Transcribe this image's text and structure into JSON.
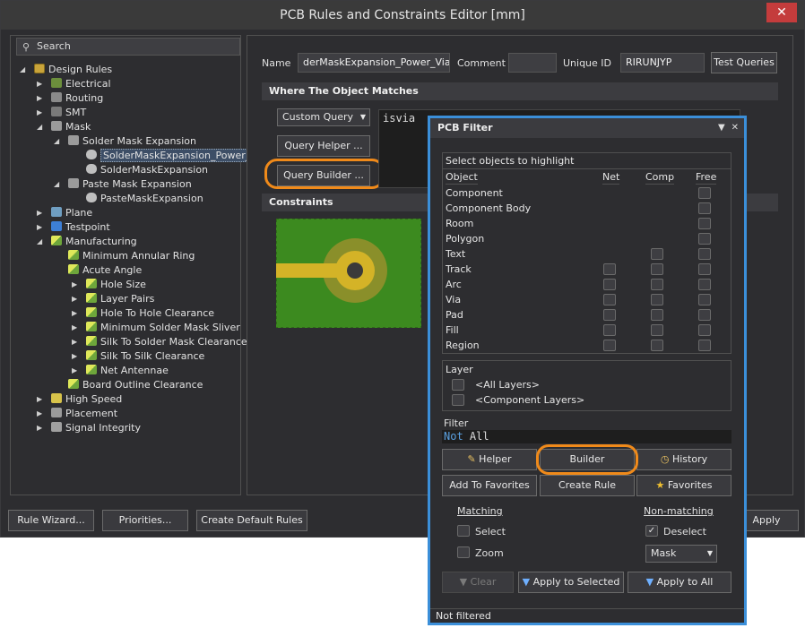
{
  "window": {
    "title": "PCB Rules and Constraints Editor [mm]",
    "close": "✕"
  },
  "search": {
    "placeholder": "Search"
  },
  "tree": {
    "root": "Design Rules",
    "electrical": "Electrical",
    "routing": "Routing",
    "smt": "SMT",
    "mask": "Mask",
    "solder_mask_expansion": "Solder Mask Expansion",
    "sme_power": "SolderMaskExpansion_Power_",
    "sme": "SolderMaskExpansion",
    "paste_mask_expansion": "Paste Mask Expansion",
    "pme": "PasteMaskExpansion",
    "plane": "Plane",
    "testpoint": "Testpoint",
    "manufacturing": "Manufacturing",
    "mfg": [
      "Minimum Annular Ring",
      "Acute Angle",
      "Hole Size",
      "Layer Pairs",
      "Hole To Hole Clearance",
      "Minimum Solder Mask Sliver",
      "Silk To Solder Mask Clearance",
      "Silk To Silk Clearance",
      "Net Antennae",
      "Board Outline Clearance"
    ],
    "high_speed": "High Speed",
    "placement": "Placement",
    "signal_integrity": "Signal Integrity"
  },
  "rule": {
    "name_label": "Name",
    "name_value": "derMaskExpansion_Power_Vias",
    "comment_label": "Comment",
    "comment_value": "",
    "uid_label": "Unique ID",
    "uid_value": "RIRUNJYP",
    "test_queries": "Test Queries",
    "where_header": "Where The Object Matches",
    "custom_query": "Custom Query",
    "query_helper": "Query Helper ...",
    "query_builder": "Query Builder ...",
    "query_text": "isvia",
    "constraints_header": "Constraints"
  },
  "bottom": {
    "rule_wizard": "Rule Wizard...",
    "priorities": "Priorities...",
    "create_default": "Create Default Rules",
    "apply": "Apply"
  },
  "filter": {
    "title": "PCB Filter",
    "select_header": "Select objects to highlight",
    "cols": {
      "object": "Object",
      "net": "Net",
      "comp": "Comp",
      "free": "Free"
    },
    "objects": [
      "Component",
      "Component Body",
      "Room",
      "Polygon",
      "Text",
      "Track",
      "Arc",
      "Via",
      "Pad",
      "Fill",
      "Region"
    ],
    "layer_header": "Layer",
    "layers": [
      "<All Layers>",
      "<Component Layers>"
    ],
    "filter_label": "Filter",
    "filter_kw": "Not",
    "filter_rest": " All",
    "helper": "Helper",
    "builder": "Builder",
    "history": "History",
    "add_fav": "Add To Favorites",
    "create_rule": "Create Rule",
    "favorites": "Favorites",
    "matching": "Matching",
    "non_matching": "Non-matching",
    "select": "Select",
    "zoom": "Zoom",
    "deselect": "Deselect",
    "mask": "Mask",
    "clear": "Clear",
    "apply_selected": "Apply to Selected",
    "apply_all": "Apply to All",
    "status": "Not filtered"
  },
  "colors": {
    "accent_orange": "#f08a1a",
    "filter_border": "#3b8fd9",
    "board_green": "#3c8a1f",
    "copper": "#d4b327"
  }
}
